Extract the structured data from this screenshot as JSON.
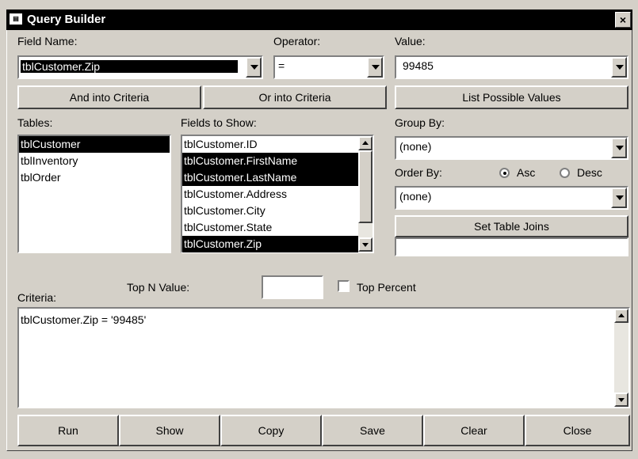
{
  "window": {
    "title": "Query Builder",
    "icon": "form-icon",
    "close_glyph": "×"
  },
  "field_name": {
    "label": "Field Name:",
    "value": "tblCustomer.Zip"
  },
  "operator": {
    "label": "Operator:",
    "value": "="
  },
  "value": {
    "label": "Value:",
    "value": "99485"
  },
  "buttons": {
    "and_into_criteria": "And into Criteria",
    "or_into_criteria": "Or into Criteria",
    "list_possible_values": "List Possible Values",
    "set_table_joins": "Set Table Joins"
  },
  "tables": {
    "label": "Tables:",
    "items": [
      {
        "label": "tblCustomer",
        "selected": true
      },
      {
        "label": "tblInventory",
        "selected": false
      },
      {
        "label": "tblOrder",
        "selected": false
      }
    ]
  },
  "fields_to_show": {
    "label": "Fields to Show:",
    "items": [
      {
        "label": "tblCustomer.ID",
        "selected": false
      },
      {
        "label": "tblCustomer.FirstName",
        "selected": true
      },
      {
        "label": "tblCustomer.LastName",
        "selected": true
      },
      {
        "label": "tblCustomer.Address",
        "selected": false
      },
      {
        "label": "tblCustomer.City",
        "selected": false
      },
      {
        "label": "tblCustomer.State",
        "selected": false
      },
      {
        "label": "tblCustomer.Zip",
        "selected": true
      }
    ]
  },
  "group_by": {
    "label": "Group By:",
    "value": "(none)"
  },
  "order_by": {
    "label": "Order By:",
    "value": "(none)",
    "asc_label": "Asc",
    "desc_label": "Desc",
    "selected": "Asc"
  },
  "criteria": {
    "label": "Criteria:",
    "text": "tblCustomer.Zip = '99485'"
  },
  "top_n": {
    "label": "Top N Value:",
    "value": "",
    "top_percent_label": "Top Percent",
    "top_percent_checked": false
  },
  "footer_buttons": {
    "run": "Run",
    "show": "Show",
    "copy": "Copy",
    "save": "Save",
    "clear": "Clear",
    "close": "Close"
  }
}
